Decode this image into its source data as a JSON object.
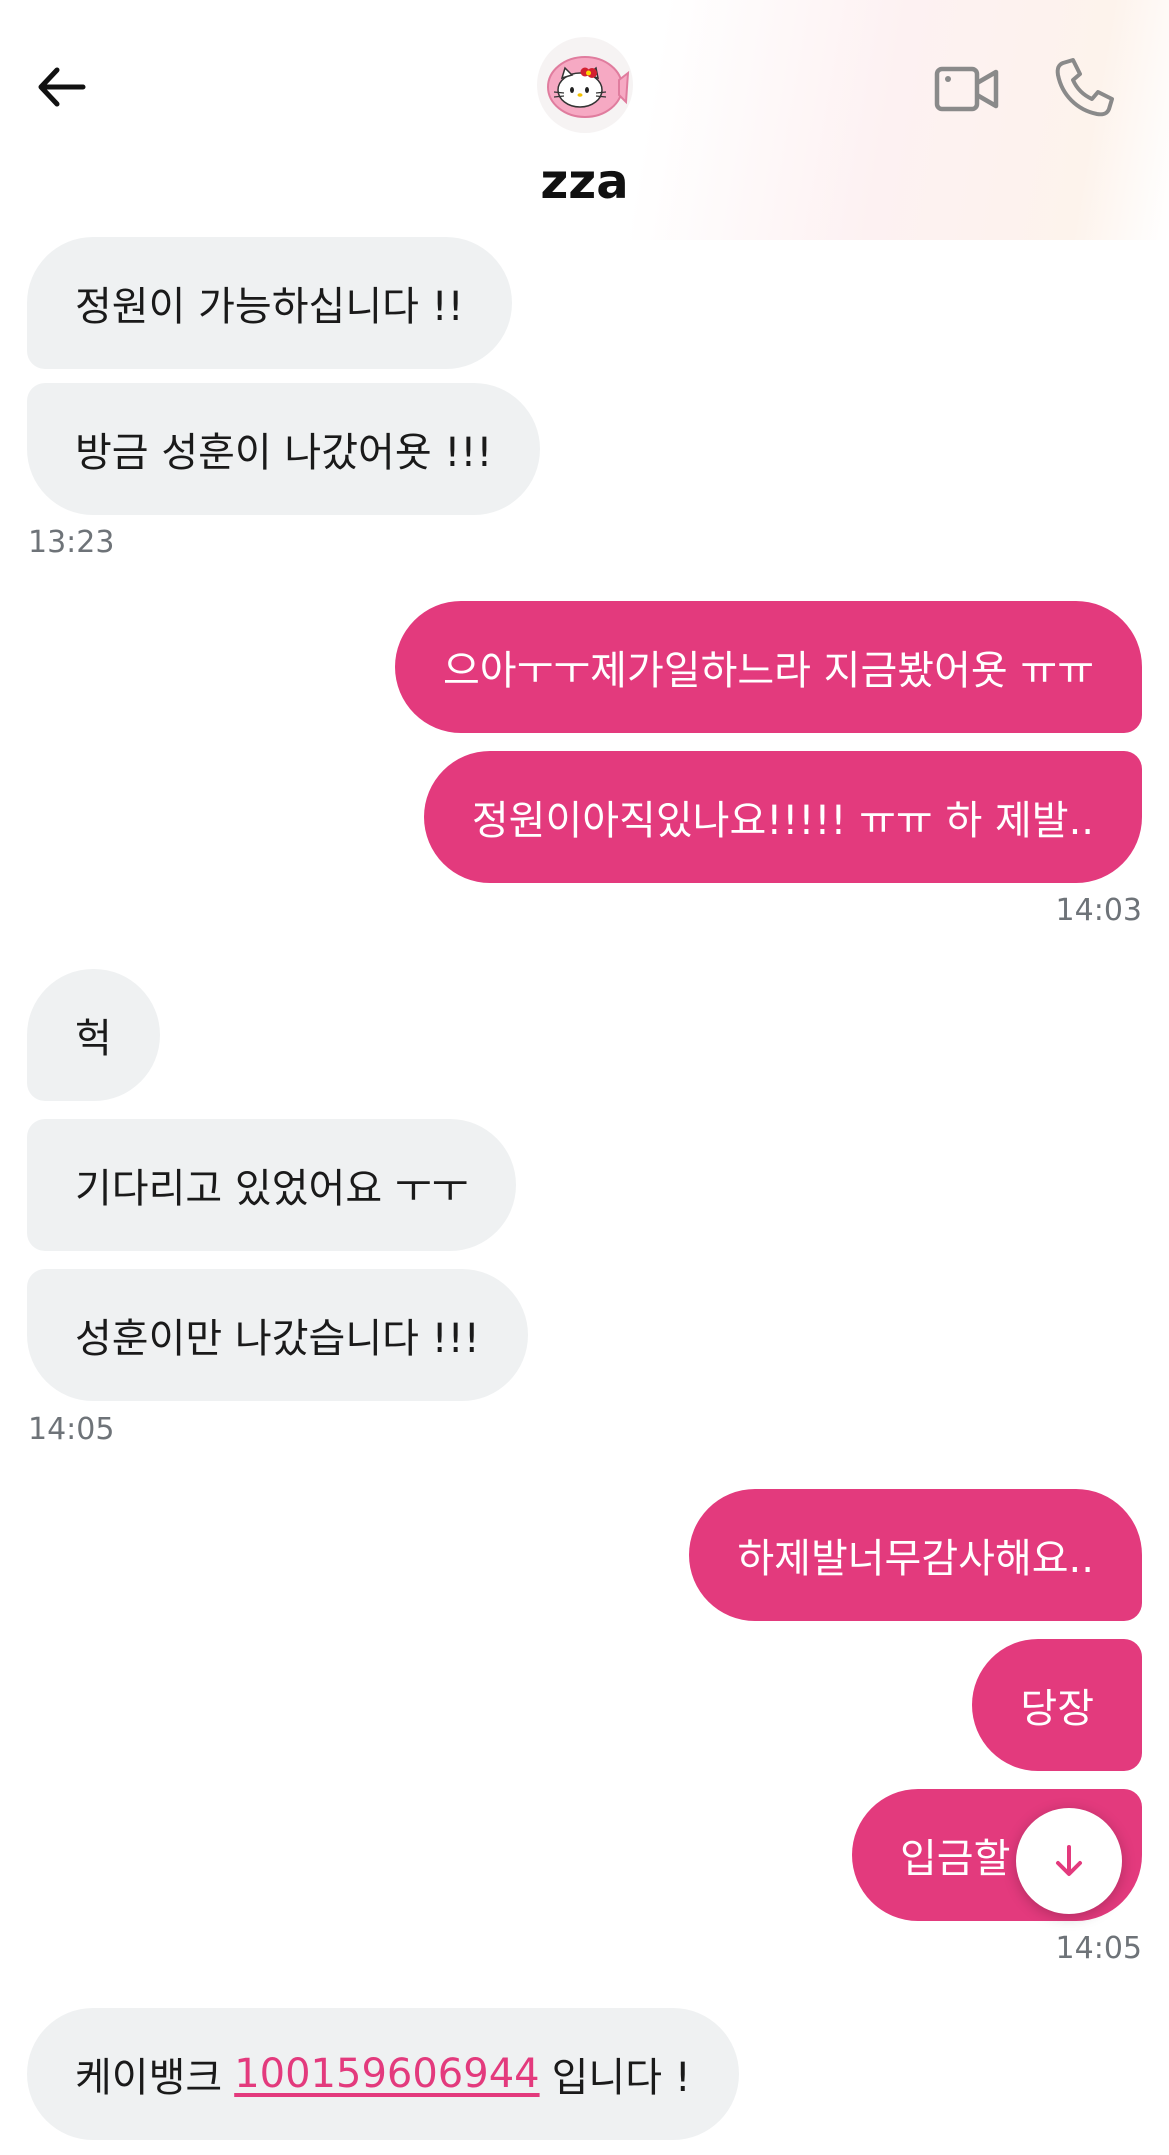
{
  "header": {
    "username": "zza",
    "icons": {
      "back": "back-arrow-icon",
      "avatar": "hello-kitty-taiyaki-avatar",
      "video": "video-camera-icon",
      "call": "phone-icon"
    }
  },
  "messages": {
    "m1": "정원이 가능하십니다 !!",
    "m2": "방금 성훈이 나갔어욧 !!!",
    "t1": "13:23",
    "m3": "으아ㅜㅜ제가일하느라 지금봤어욧 ㅠㅠ",
    "m4": "정원이아직있나요!!!!! ㅠㅠ 하 제발..",
    "t2": "14:03",
    "m5": "헉",
    "m6": "기다리고 있었어요 ㅜㅜ",
    "m7": "성훈이만 나갔습니다 !!!",
    "t3": "14:05",
    "m8": "하제발너무감사해요..",
    "m9": "당장",
    "m10": "입금할",
    "t4": "14:05",
    "m11_pre": "케이뱅크",
    "m11_link": "100159606944",
    "m11_post": "입니다 !"
  },
  "colors": {
    "outgoing_bubble": "#e33a7d",
    "incoming_bubble": "#eff1f2",
    "link": "#e33a7d"
  },
  "scroll_button": {
    "icon": "arrow-down-icon"
  }
}
